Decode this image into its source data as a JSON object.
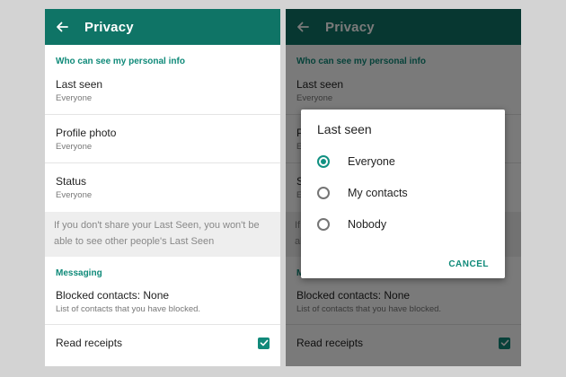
{
  "appbar": {
    "title": "Privacy"
  },
  "sections": {
    "personal_info_header": "Who can see my personal info",
    "messaging_header": "Messaging"
  },
  "settings": {
    "last_seen": {
      "label": "Last seen",
      "value": "Everyone"
    },
    "profile_photo": {
      "label": "Profile photo",
      "value": "Everyone"
    },
    "status": {
      "label": "Status",
      "value": "Everyone"
    },
    "note": "If you don't share your Last Seen, you won't be able to see other people's Last Seen",
    "blocked": {
      "label": "Blocked contacts: None",
      "description": "List of contacts that you have blocked."
    },
    "read_receipts": {
      "label": "Read receipts",
      "checked": true
    }
  },
  "dialog": {
    "title": "Last seen",
    "options": [
      "Everyone",
      "My contacts",
      "Nobody"
    ],
    "selected": "Everyone",
    "cancel_label": "CANCEL"
  },
  "colors": {
    "appbar": "#0f7466",
    "accent": "#0f8a79",
    "background": "#d3d3d3"
  },
  "icons": {
    "back": "arrow-left-icon",
    "check": "checkmark-icon"
  }
}
